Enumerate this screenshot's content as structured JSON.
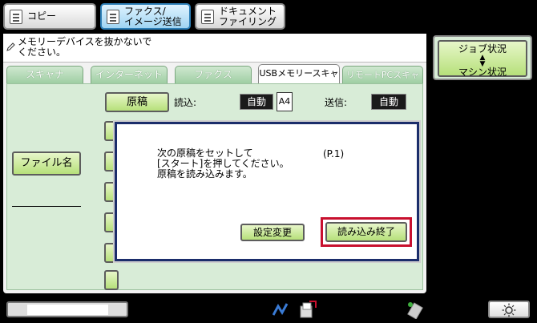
{
  "modes": [
    {
      "label": "コピー",
      "active": false
    },
    {
      "label": "ファクス/\nイメージ送信",
      "active": true
    },
    {
      "label": "ドキュメント\nファイリング",
      "active": false
    }
  ],
  "message": "メモリーデバイスを抜かないで\nください。",
  "tabs": [
    "スキャナ",
    "インターネットFax",
    "ファクス",
    "USBメモリースキャン",
    "リモートPCスキャン"
  ],
  "active_tab": "USBメモリースキャン",
  "settings": {
    "original_label": "原稿",
    "read_label": "読込:",
    "read_value": "自動",
    "paper_size": "A4",
    "send_label": "送信:",
    "send_value": "自動"
  },
  "filename_button": "ファイル名",
  "dialog": {
    "message": "次の原稿をセットして\n[スタート]を押してください。\n原稿を読み込みます。",
    "page": "(P.1)",
    "change_settings_button": "設定変更",
    "finish_reading_button": "読み込み終了"
  },
  "right_panel": {
    "job_status": "ジョブ状況",
    "machine_status": "マシン状況"
  },
  "bottom": {
    "progress": 0.84
  },
  "colors": {
    "highlight_box": "#c8102e",
    "dialog_border": "#1b2d6b",
    "active_tab_bg": "#9fd4f2"
  }
}
